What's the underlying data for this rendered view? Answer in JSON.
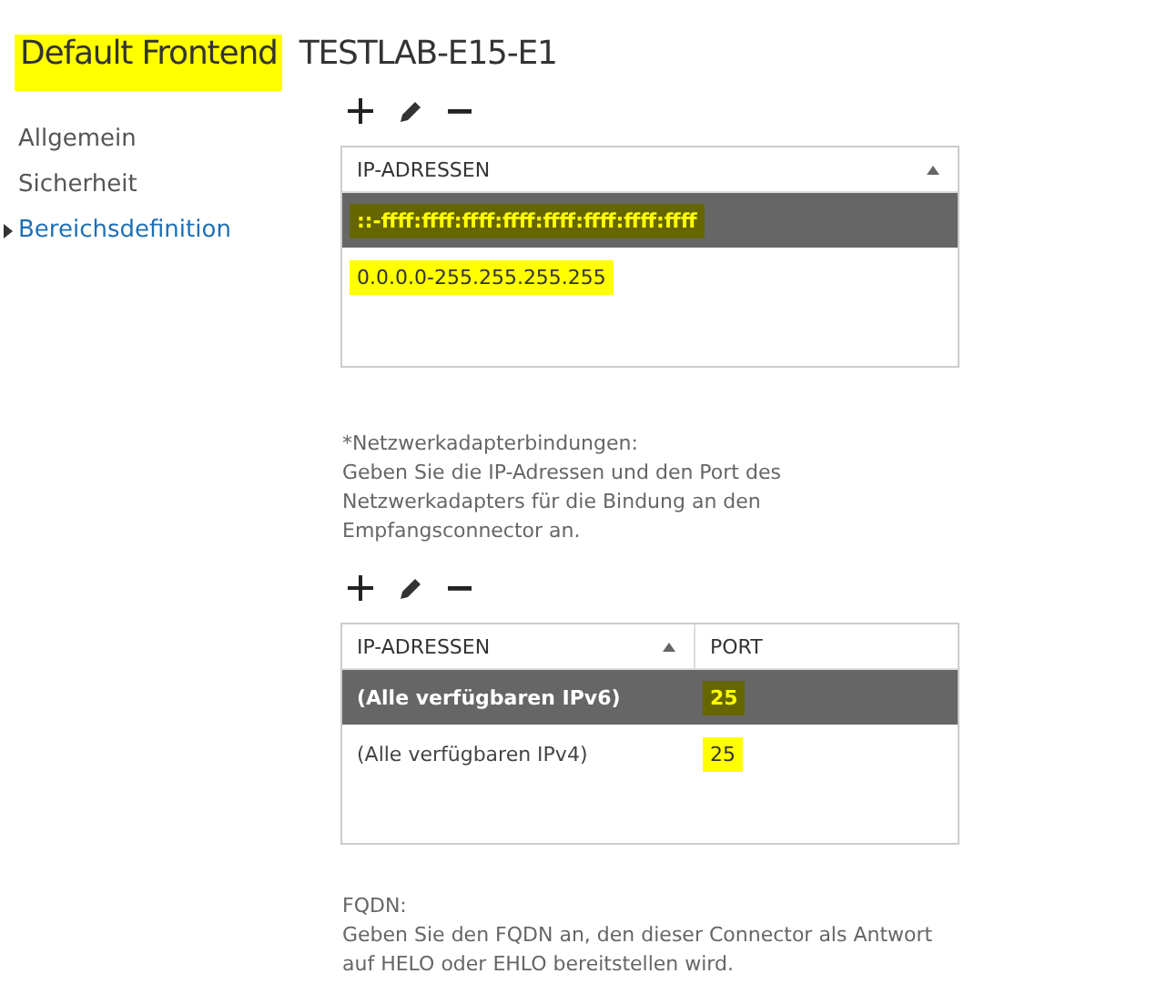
{
  "title": [
    {
      "text": "Default Frontend",
      "highlighted": true
    },
    {
      "text": "TESTLAB-E15-E1",
      "highlighted": false
    }
  ],
  "sidebar": {
    "items": [
      {
        "label": "Allgemein",
        "selected": false
      },
      {
        "label": "Sicherheit",
        "selected": false
      },
      {
        "label": "Bereichsdefinition",
        "selected": true
      }
    ]
  },
  "remote_ranges": {
    "table": {
      "columns": [
        {
          "label": "IP-ADRESSEN",
          "sorted": true
        }
      ],
      "rows": [
        {
          "selected": true,
          "cells": [
            {
              "text": "::-ffff:ffff:ffff:ffff:ffff:ffff:ffff:ffff",
              "highlighted": true
            }
          ]
        },
        {
          "selected": false,
          "cells": [
            {
              "text": "0.0.0.0-255.255.255.255",
              "highlighted": true
            }
          ]
        }
      ]
    }
  },
  "bindings": {
    "label": "*Netzwerkadapterbindungen:",
    "description": "Geben Sie die IP-Adressen und den Port des Netzwerkadapters für die Bindung an den Empfangsconnector an.",
    "table": {
      "columns": [
        {
          "label": "IP-ADRESSEN",
          "sorted": true
        },
        {
          "label": "PORT",
          "sorted": false
        }
      ],
      "rows": [
        {
          "selected": true,
          "cells": [
            {
              "text": "(Alle verfügbaren IPv6)",
              "highlighted": false
            },
            {
              "text": "25",
              "highlighted": true
            }
          ]
        },
        {
          "selected": false,
          "cells": [
            {
              "text": "(Alle verfügbaren IPv4)",
              "highlighted": false
            },
            {
              "text": "25",
              "highlighted": true
            }
          ]
        }
      ]
    }
  },
  "fqdn": {
    "label": "FQDN:",
    "description": "Geben Sie den FQDN an, den dieser Connector als Antwort auf HELO oder EHLO bereitstellen wird."
  }
}
